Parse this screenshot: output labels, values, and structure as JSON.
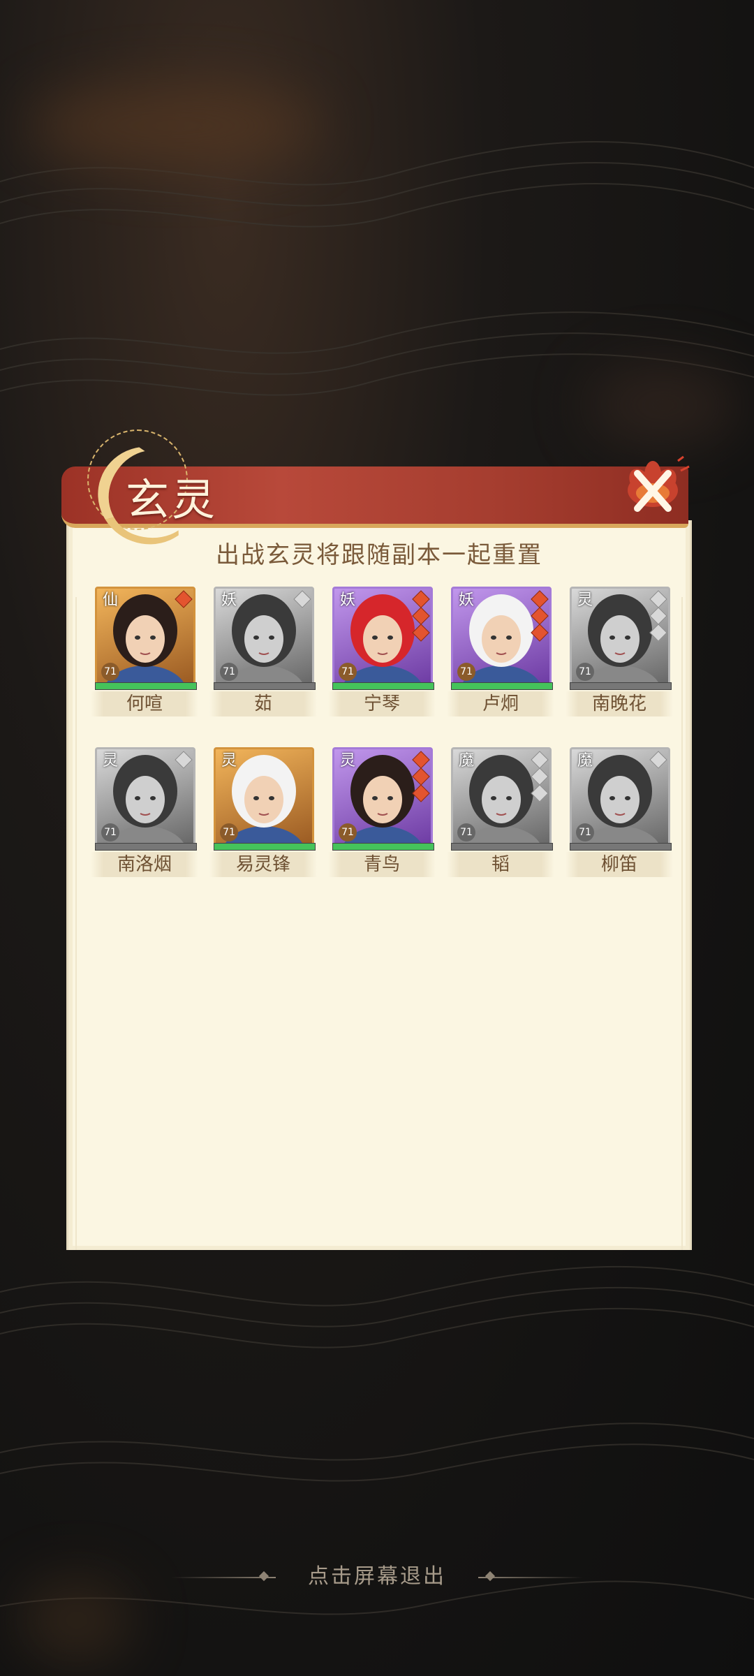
{
  "dialog": {
    "title": "玄灵",
    "subtitle": "出战玄灵将跟随副本一起重置"
  },
  "characters": [
    {
      "name": "何喧",
      "faction": "仙",
      "level": "71",
      "frame": "gold",
      "hp": 1.0,
      "gems": [
        "red"
      ]
    },
    {
      "name": "茹",
      "faction": "妖",
      "level": "71",
      "frame": "gray",
      "hp": 0.0,
      "gems": [
        "gray"
      ]
    },
    {
      "name": "宁琴",
      "faction": "妖",
      "level": "71",
      "frame": "purple",
      "hp": 1.0,
      "gems": [
        "red",
        "red",
        "red"
      ]
    },
    {
      "name": "卢炯",
      "faction": "妖",
      "level": "71",
      "frame": "purple",
      "hp": 1.0,
      "gems": [
        "red",
        "red",
        "red"
      ]
    },
    {
      "name": "南晚花",
      "faction": "灵",
      "level": "71",
      "frame": "gray",
      "hp": 0.0,
      "gems": [
        "gray",
        "gray",
        "gray"
      ]
    },
    {
      "name": "南洛烟",
      "faction": "灵",
      "level": "71",
      "frame": "gray",
      "hp": 0.0,
      "gems": [
        "gray"
      ]
    },
    {
      "name": "易灵锋",
      "faction": "灵",
      "level": "71",
      "frame": "gold",
      "hp": 1.0,
      "gems": []
    },
    {
      "name": "青鸟",
      "faction": "灵",
      "level": "71",
      "frame": "purple",
      "hp": 1.0,
      "gems": [
        "red",
        "red",
        "red"
      ]
    },
    {
      "name": "韬",
      "faction": "魔",
      "level": "71",
      "frame": "gray",
      "hp": 0.0,
      "gems": [
        "gray",
        "gray",
        "gray"
      ]
    },
    {
      "name": "柳笛",
      "faction": "魔",
      "level": "71",
      "frame": "gray",
      "hp": 0.0,
      "gems": [
        "gray"
      ]
    }
  ],
  "footer": {
    "exit_hint": "点击屏幕退出"
  },
  "icons": {
    "close": "close-icon",
    "moon": "moon-emblem-icon"
  },
  "colors": {
    "panel": "#fbf6e2",
    "banner": "#b8493a",
    "accent": "#d8a75c",
    "hp": "#45c35b"
  }
}
